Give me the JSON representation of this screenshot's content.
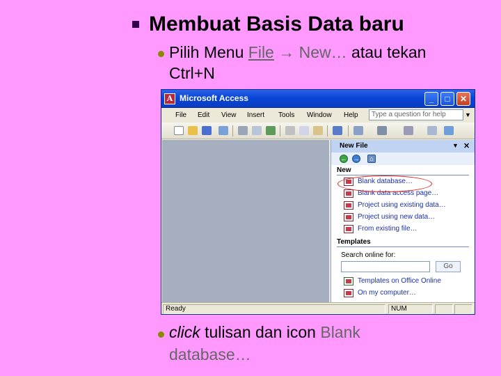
{
  "slide": {
    "title": "Membuat Basis Data baru",
    "point1": {
      "prefix": "Pilih Menu ",
      "menu_file": "File",
      "arrow": "→",
      "menu_new": "New…",
      "suffix": " atau tekan",
      "line2": "Ctrl+N"
    },
    "point2": {
      "word_click": "click",
      "middle": " tulisan dan icon ",
      "link": "Blank",
      "line2": "database…"
    }
  },
  "window": {
    "title": "Microsoft Access",
    "menus": [
      "File",
      "Edit",
      "View",
      "Insert",
      "Tools",
      "Window",
      "Help"
    ],
    "help_placeholder": "Type a question for help",
    "task_pane": {
      "title": "New File",
      "section_new": "New",
      "new_items": [
        "Blank database…",
        "Blank data access page…",
        "Project using existing data…",
        "Project using new data…",
        "From existing file…"
      ],
      "section_templates": "Templates",
      "search_label": "Search online for:",
      "go_label": "Go",
      "template_items": [
        "Templates on Office Online",
        "On my computer…"
      ]
    },
    "status": {
      "left": "Ready",
      "num": "NUM"
    }
  },
  "colors": {
    "background": "#ff99ff",
    "titlebar": "#0846d6",
    "highlight_oval": "#e02020"
  }
}
